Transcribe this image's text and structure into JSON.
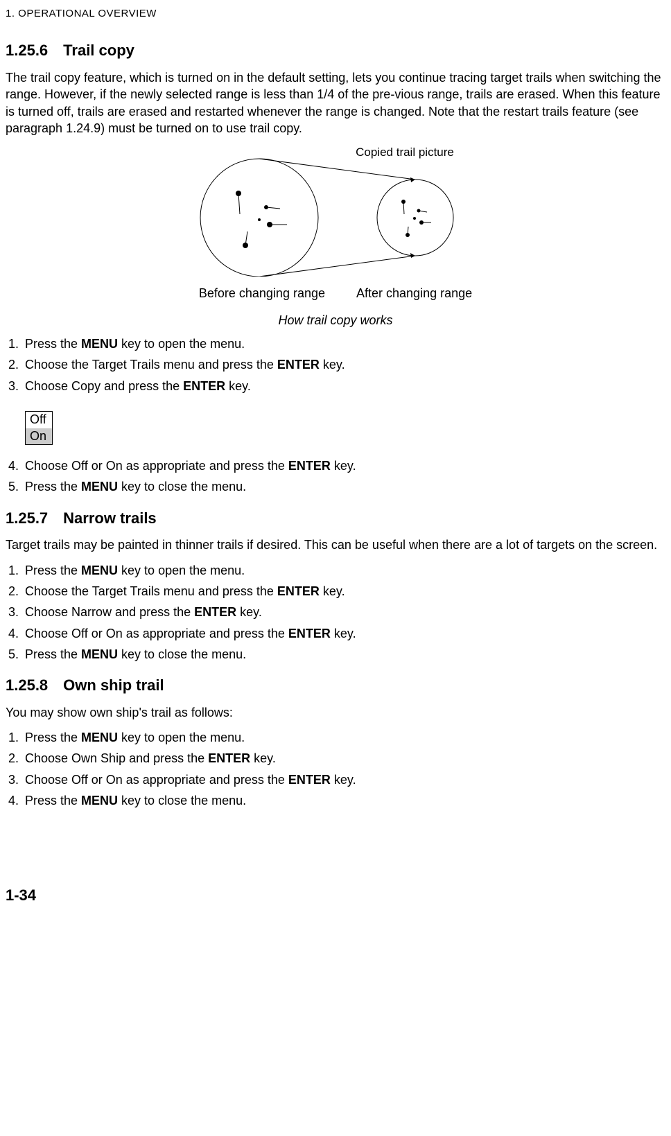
{
  "chapterHeader": "1. OPERATIONAL OVERVIEW",
  "section1": {
    "number": "1.25.6",
    "title": "Trail copy",
    "body": "The trail copy feature, which is turned on in the default setting, lets you continue tracing target trails when switching the range. However, if the newly selected range is less than 1/4 of the pre-vious range, trails are erased. When this feature is turned off, trails are erased and restarted whenever the range is changed. Note that the restart trails feature (see paragraph 1.24.9) must be turned on to use trail copy.",
    "figure": {
      "labelTop": "Copied trail picture",
      "labelLeft": "Before changing range",
      "labelRight": "After changing range",
      "caption": "How trail copy works"
    },
    "steps_a": {
      "s1_pre": "Press the ",
      "s1_b": "MENU",
      "s1_post": " key to open the menu.",
      "s2_pre": "Choose the Target Trails menu and press the ",
      "s2_b": "ENTER",
      "s2_post": " key.",
      "s3_pre": "Choose Copy and press the ",
      "s3_b": "ENTER",
      "s3_post": " key."
    },
    "optionBox": {
      "off": "Off",
      "on": "On"
    },
    "steps_b": {
      "s4_pre": "Choose Off or On as appropriate and press the ",
      "s4_b": "ENTER",
      "s4_post": " key.",
      "s5_pre": "Press the ",
      "s5_b": "MENU",
      "s5_post": " key to close the menu."
    }
  },
  "section2": {
    "number": "1.25.7",
    "title": "Narrow trails",
    "body": "Target trails may be painted in thinner trails if desired. This can be useful when there are a lot of targets on the screen.",
    "steps": {
      "s1_pre": "Press the ",
      "s1_b": "MENU",
      "s1_post": " key to open the menu.",
      "s2_pre": "Choose the Target Trails menu and press the ",
      "s2_b": "ENTER",
      "s2_post": " key.",
      "s3_pre": "Choose Narrow and press the ",
      "s3_b": "ENTER",
      "s3_post": " key.",
      "s4_pre": "Choose Off or On as appropriate and press the ",
      "s4_b": "ENTER",
      "s4_post": " key.",
      "s5_pre": "Press the ",
      "s5_b": "MENU",
      "s5_post": " key to close the menu."
    }
  },
  "section3": {
    "number": "1.25.8",
    "title": "Own ship trail",
    "body": "You may show own ship's trail as follows:",
    "steps": {
      "s1_pre": "Press the ",
      "s1_b": "MENU",
      "s1_post": " key to open the menu.",
      "s2_pre": "Choose Own Ship and press the ",
      "s2_b": "ENTER",
      "s2_post": " key.",
      "s3_pre": "Choose Off or On as appropriate and press the ",
      "s3_b": "ENTER",
      "s3_post": " key.",
      "s4_pre": "Press the ",
      "s4_b": "MENU",
      "s4_post": " key to close the menu."
    }
  },
  "pageNumber": "1-34"
}
